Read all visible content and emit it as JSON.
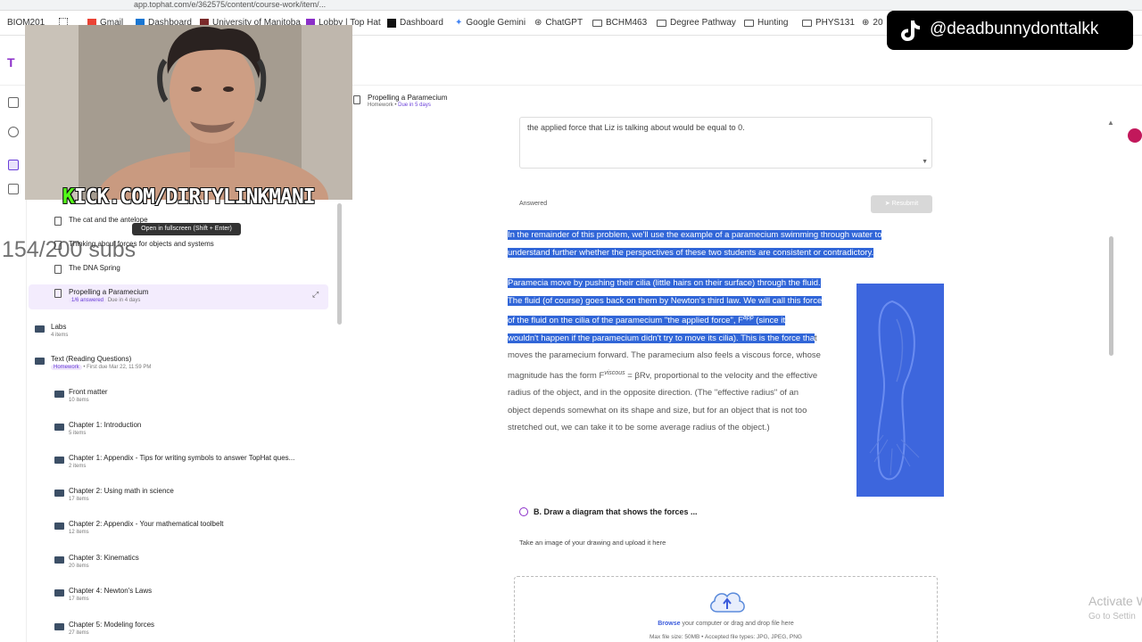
{
  "browser": {
    "url_fragment": "app.tophat.com/e/362575/content/course-work/item/...",
    "bookmarks": [
      {
        "label": "BIOM201",
        "icon": "text"
      },
      {
        "label": "Gmail",
        "icon": "gmail-icon"
      },
      {
        "label": "Dashboard",
        "icon": "dashboard-icon"
      },
      {
        "label": "University of Manitoba",
        "icon": "um-icon"
      },
      {
        "label": "Lobby | Top Hat",
        "icon": "tophat-icon"
      },
      {
        "label": "Dashboard",
        "icon": "zybooks-icon"
      },
      {
        "label": "Google Gemini",
        "icon": "gemini-icon"
      },
      {
        "label": "ChatGPT",
        "icon": "chatgpt-icon"
      },
      {
        "label": "BCHM463",
        "icon": "folder-icon"
      },
      {
        "label": "Degree Pathway",
        "icon": "folder-icon"
      },
      {
        "label": "Hunting",
        "icon": "folder-icon"
      },
      {
        "label": "PHYS131",
        "icon": "folder-icon"
      },
      {
        "label": "20",
        "icon": "globe-icon"
      }
    ]
  },
  "overlay": {
    "kick_k": "K",
    "kick_rest": "ICK.COM/DIRTYLINKMANI",
    "subs": "154/200 subs",
    "tiktok_handle": "@deadbunnydonttalkk",
    "tooltip": "Open in fullscreen (Shift + Enter)"
  },
  "sidebar": {
    "items": [
      {
        "title": "The cat and the antelope",
        "type": "doc"
      },
      {
        "title": "Thinking about forces for objects and systems",
        "type": "doc"
      },
      {
        "title": "The DNA Spring",
        "type": "doc"
      },
      {
        "title": "Propelling a Paramecium",
        "type": "doc",
        "answered": "1/6 answered",
        "due": "Due in 4 days",
        "selected": true
      },
      {
        "title": "Labs",
        "sub": "4 items",
        "type": "folder"
      },
      {
        "title": "Text (Reading Questions)",
        "tag": "Homework",
        "sub": "First due Mar 22, 11:59 PM",
        "type": "folder"
      },
      {
        "title": "Front matter",
        "sub": "10 items",
        "type": "folder"
      },
      {
        "title": "Chapter 1: Introduction",
        "sub": "5 items",
        "type": "folder"
      },
      {
        "title": "Chapter 1: Appendix - Tips for writing symbols to answer TopHat ques...",
        "sub": "2 items",
        "type": "folder"
      },
      {
        "title": "Chapter 2: Using math in science",
        "sub": "17 items",
        "type": "folder"
      },
      {
        "title": "Chapter 2: Appendix - Your mathematical toolbelt",
        "sub": "12 items",
        "type": "folder"
      },
      {
        "title": "Chapter 3: Kinematics",
        "sub": "20 items",
        "type": "folder"
      },
      {
        "title": "Chapter 4: Newton's Laws",
        "sub": "17 items",
        "type": "folder"
      },
      {
        "title": "Chapter 5: Modeling forces",
        "sub": "27 items",
        "type": "folder"
      }
    ]
  },
  "header": {
    "title": "Propelling a Paramecium",
    "type": "Homework",
    "due": "Due in 5 days"
  },
  "answer": {
    "text": "the applied force that Liz is talking about would be equal to 0.",
    "status": "Answered",
    "resubmit": "Resubmit"
  },
  "content": {
    "para1_lines": [
      "In the remainder of this problem, we'll use the example of a paramecium swimming through water to",
      "understand further whether the perspectives of these two students are consistent or contradictory."
    ],
    "para2_l1": "Paramecia move by pushing their cilia (little hairs on their surface) through the fluid.",
    "para2_l2": "The fluid (of course) goes back on them by Newton's third law. We will call this force",
    "para2_l3a": "of the fluid on the cilia of the paramecium \"the applied force\", F",
    "para2_l3sup": "app",
    "para2_l3b": " (since it",
    "para2_l4a": "wouldn't happen if the paramecium didn't try to move its cilia). This is the force tha",
    "para2_l4b": "t",
    "para2_l5": "moves the paramecium forward. The paramecium also feels a viscous force, whose",
    "para2_l6a": "magnitude has the form F",
    "para2_l6sup": "viscous",
    "para2_l6b": " = βRv, proportional to the velocity and the effective",
    "para2_l7": "radius of the object, and in the opposite direction. (The \"effective radius\" of an",
    "para2_l8": "object depends somewhat on its shape and size, but for an object that is not too",
    "para2_l9": "stretched out, we can take it to be some average radius of the object.)"
  },
  "question_b": {
    "title": "B. Draw a diagram that shows the forces ...",
    "prompt": "Take an image of your drawing and upload it here",
    "browse": "Browse",
    "upload_text": " your computer or drag and drop file here",
    "limits": "Max file size: 50MB • Accepted file types: JPG, JPEG, PNG"
  },
  "watermark": {
    "line1": "Activate W",
    "line2": "Go to Settin"
  },
  "colors": {
    "accent": "#6a3fd9",
    "highlight": "#3166d8",
    "kick_green": "#53fc18"
  }
}
